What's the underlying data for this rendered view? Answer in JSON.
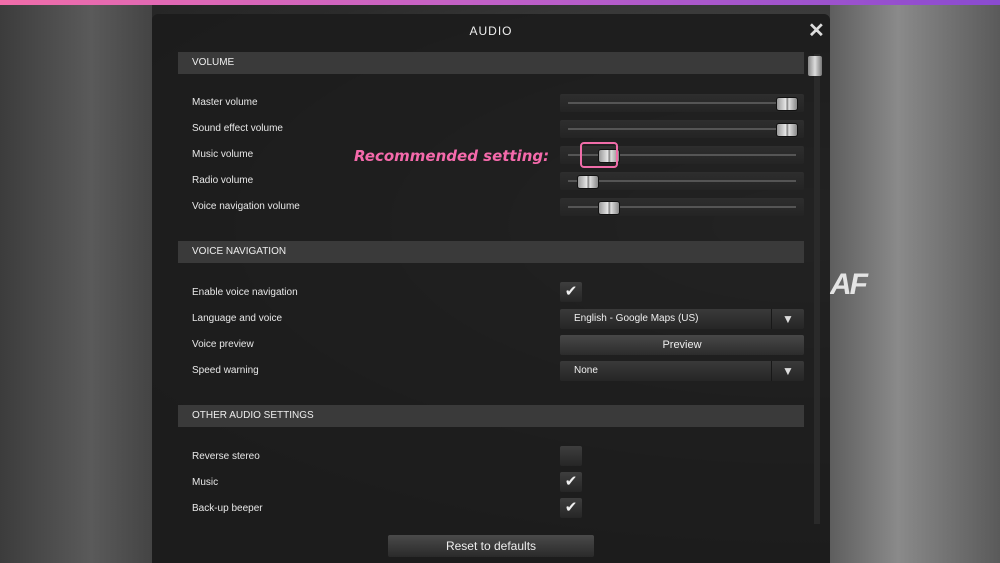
{
  "window": {
    "title": "AUDIO",
    "close_icon": "close-icon"
  },
  "annotation": {
    "text": "Recommended setting:",
    "color": "#f56aab"
  },
  "volume": {
    "header": "VOLUME",
    "rows": [
      {
        "label": "Master volume",
        "level": 1.0
      },
      {
        "label": "Sound effect volume",
        "level": 1.0
      },
      {
        "label": "Music volume",
        "level": 0.15
      },
      {
        "label": "Radio volume",
        "level": 0.05
      },
      {
        "label": "Voice navigation volume",
        "level": 0.15
      }
    ]
  },
  "voice_navigation": {
    "header": "VOICE NAVIGATION",
    "enable_label": "Enable voice navigation",
    "enable_checked": true,
    "language_label": "Language and voice",
    "language_value": "English - Google Maps (US)",
    "preview_label": "Voice preview",
    "preview_button": "Preview",
    "speed_label": "Speed warning",
    "speed_value": "None"
  },
  "other": {
    "header": "OTHER AUDIO SETTINGS",
    "reverse_label": "Reverse stereo",
    "reverse_checked": false,
    "music_label": "Music",
    "music_checked": true,
    "beeper_label": "Back-up beeper",
    "beeper_checked": true
  },
  "footer": {
    "reset_label": "Reset to defaults"
  },
  "background": {
    "truck_logo": "AF"
  }
}
